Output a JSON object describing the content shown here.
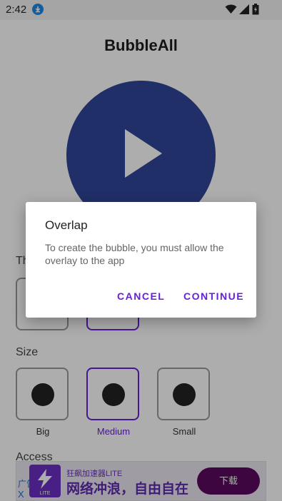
{
  "status_bar": {
    "time": "2:42"
  },
  "app": {
    "title": "BubbleAll"
  },
  "theme_section": {
    "label": "Th"
  },
  "size_section": {
    "label": "Size",
    "options": [
      {
        "label": "Big",
        "selected": false
      },
      {
        "label": "Medium",
        "selected": true
      },
      {
        "label": "Small",
        "selected": false
      }
    ]
  },
  "access_section": {
    "label": "Access"
  },
  "ad": {
    "tag": "广告",
    "close": "X",
    "logo_text": "LITE",
    "brand": "狂飙加速器LITE",
    "slogan": "网络冲浪，自由自在",
    "button": "下载"
  },
  "dialog": {
    "title": "Overlap",
    "message": "To create the bubble, you must allow the overlay to the app",
    "cancel": "CANCEL",
    "continue": "CONTINUE"
  },
  "colors": {
    "accent": "#6a1fd6",
    "play_button": "#31469a",
    "ad_button": "#5b0a5f"
  }
}
